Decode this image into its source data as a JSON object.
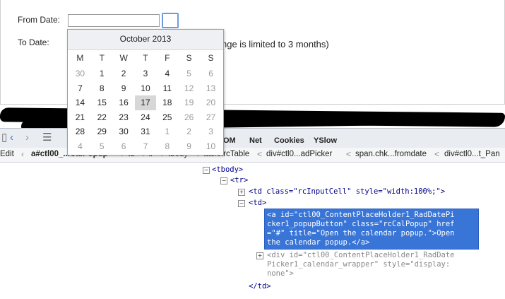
{
  "form": {
    "from_label": "From Date:",
    "to_label": "To Date:",
    "from_value": "",
    "range_note": "nge is limited to 3 months)"
  },
  "calendar": {
    "title": "October 2013",
    "weekdays": [
      "M",
      "T",
      "W",
      "T",
      "F",
      "S",
      "S"
    ],
    "weeks": [
      [
        "30",
        "1",
        "2",
        "3",
        "4",
        "5",
        "6"
      ],
      [
        "7",
        "8",
        "9",
        "10",
        "11",
        "12",
        "13"
      ],
      [
        "14",
        "15",
        "16",
        "17",
        "18",
        "19",
        "20"
      ],
      [
        "21",
        "22",
        "23",
        "24",
        "25",
        "26",
        "27"
      ],
      [
        "28",
        "29",
        "30",
        "31",
        "1",
        "2",
        "3"
      ],
      [
        "4",
        "5",
        "6",
        "7",
        "8",
        "9",
        "10"
      ]
    ],
    "highlighted_day": "17"
  },
  "firebug": {
    "tabs": [
      "OM",
      "Net",
      "Cookies",
      "YSlow"
    ],
    "edit_label": "Edit",
    "breadcrumbs": [
      "a#ctl00_...CalPopup",
      "td",
      "tr",
      "tbody",
      "table.rcTable",
      "div#ctl0...adPicker",
      "span.chk...fromdate",
      "div#ctl0...t_Pan"
    ],
    "code": {
      "tbody": "<tbody>",
      "tr": "<tr>",
      "td_input": "<td class=\"rcInputCell\" style=\"width:100%;\">",
      "td": "<td>",
      "a_line1": "<a id=\"ctl00_ContentPlaceHolder1_RadDatePi",
      "a_line2": "cker1_popupButton\" class=\"rcCalPopup\" href",
      "a_line3": "=\"#\" title=\"Open the calendar popup.\">Open",
      "a_line4": "the calendar popup.</a>",
      "div_line1": "<div id=\"ctl00_ContentPlaceHolder1_RadDate",
      "div_line2": "Picker1_calendar_wrapper\" style=\"display:",
      "div_line3": "none\">",
      "td_close": "</td>"
    }
  }
}
